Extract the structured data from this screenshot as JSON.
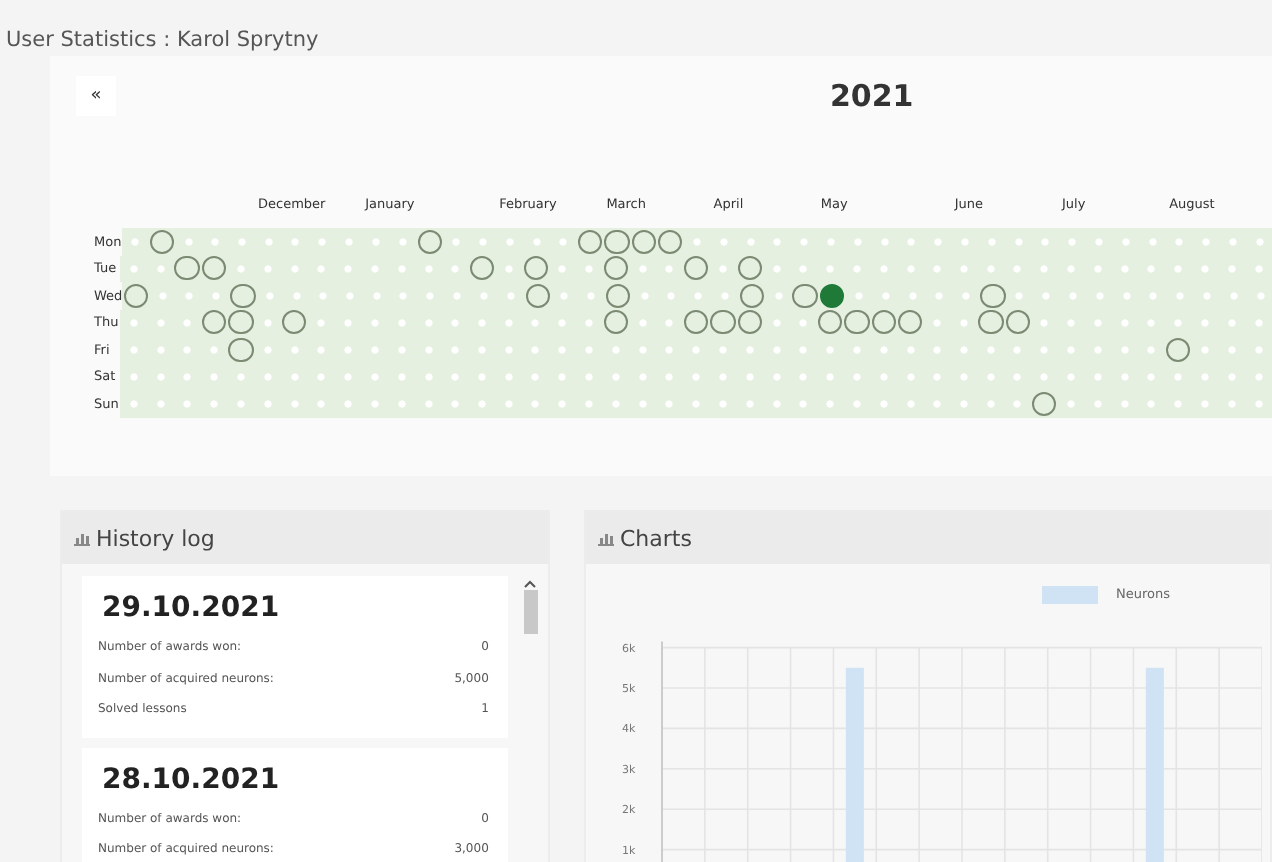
{
  "page_title": "User Statistics : Karol Sprytny",
  "calendar": {
    "back_button": "«",
    "year": "2021",
    "months": [
      {
        "label": "December"
      },
      {
        "label": "January"
      },
      {
        "label": "February"
      },
      {
        "label": "March"
      },
      {
        "label": "April"
      },
      {
        "label": "May"
      },
      {
        "label": "June"
      },
      {
        "label": "July"
      },
      {
        "label": "August"
      }
    ],
    "rows": [
      {
        "label": "Mon",
        "cells": [
          {
            "active": false
          },
          {
            "active": true
          },
          {
            "active": false
          },
          {
            "active": false
          },
          {
            "active": false
          },
          {
            "active": false
          },
          {
            "active": false
          },
          {
            "active": false
          },
          {
            "active": false
          },
          {
            "active": false
          },
          {
            "active": false
          },
          {
            "active": true
          },
          {
            "active": false
          },
          {
            "active": false
          },
          {
            "active": false
          },
          {
            "active": false
          },
          {
            "active": false
          },
          {
            "active": true
          },
          {
            "active": true
          },
          {
            "active": true
          },
          {
            "active": true
          },
          {
            "active": false
          },
          {
            "active": false
          },
          {
            "active": false
          },
          {
            "active": false
          },
          {
            "active": false
          },
          {
            "active": false
          },
          {
            "active": false
          },
          {
            "active": false
          },
          {
            "active": false
          },
          {
            "active": false
          },
          {
            "active": false
          },
          {
            "active": false
          },
          {
            "active": false
          },
          {
            "active": false
          },
          {
            "active": false
          },
          {
            "active": false
          },
          {
            "active": false
          },
          {
            "active": false
          },
          {
            "active": false
          },
          {
            "active": false
          },
          {
            "active": false
          },
          {
            "active": false
          }
        ]
      },
      {
        "label": "Tue",
        "cells": [
          {
            "active": false
          },
          {
            "active": false
          },
          {
            "active": true
          },
          {
            "active": true
          },
          {
            "active": false
          },
          {
            "active": false
          },
          {
            "active": false
          },
          {
            "active": false
          },
          {
            "active": false
          },
          {
            "active": false
          },
          {
            "active": false
          },
          {
            "active": false
          },
          {
            "active": false
          },
          {
            "active": true
          },
          {
            "active": false
          },
          {
            "active": true
          },
          {
            "active": false
          },
          {
            "active": false
          },
          {
            "active": true
          },
          {
            "active": false
          },
          {
            "active": false
          },
          {
            "active": true
          },
          {
            "active": false
          },
          {
            "active": true
          },
          {
            "active": false
          },
          {
            "active": false
          },
          {
            "active": false
          },
          {
            "active": false
          },
          {
            "active": false
          },
          {
            "active": false
          },
          {
            "active": false
          },
          {
            "active": false
          },
          {
            "active": false
          },
          {
            "active": false
          },
          {
            "active": false
          },
          {
            "active": false
          },
          {
            "active": false
          },
          {
            "active": false
          },
          {
            "active": false
          },
          {
            "active": false
          },
          {
            "active": false
          },
          {
            "active": false
          },
          {
            "active": false
          }
        ]
      },
      {
        "label": "Wed",
        "cells": [
          {
            "active": true
          },
          {
            "active": false
          },
          {
            "active": false
          },
          {
            "active": false
          },
          {
            "active": true
          },
          {
            "active": false
          },
          {
            "active": false
          },
          {
            "active": false
          },
          {
            "active": false
          },
          {
            "active": false
          },
          {
            "active": false
          },
          {
            "active": false
          },
          {
            "active": false
          },
          {
            "active": false
          },
          {
            "active": false
          },
          {
            "active": true
          },
          {
            "active": false
          },
          {
            "active": false
          },
          {
            "active": true
          },
          {
            "active": false
          },
          {
            "active": false
          },
          {
            "active": false
          },
          {
            "active": false
          },
          {
            "active": true
          },
          {
            "active": false
          },
          {
            "active": true
          },
          {
            "active": true,
            "selected": true
          },
          {
            "active": false
          },
          {
            "active": false
          },
          {
            "active": false
          },
          {
            "active": false
          },
          {
            "active": false
          },
          {
            "active": true
          },
          {
            "active": false
          },
          {
            "active": false
          },
          {
            "active": false
          },
          {
            "active": false
          },
          {
            "active": false
          },
          {
            "active": false
          },
          {
            "active": false
          },
          {
            "active": false
          },
          {
            "active": false
          },
          {
            "active": false
          }
        ]
      },
      {
        "label": "Thu",
        "cells": [
          {
            "active": false
          },
          {
            "active": false
          },
          {
            "active": false
          },
          {
            "active": true
          },
          {
            "active": true
          },
          {
            "active": false
          },
          {
            "active": true
          },
          {
            "active": false
          },
          {
            "active": false
          },
          {
            "active": false
          },
          {
            "active": false
          },
          {
            "active": false
          },
          {
            "active": false
          },
          {
            "active": false
          },
          {
            "active": false
          },
          {
            "active": false
          },
          {
            "active": false
          },
          {
            "active": false
          },
          {
            "active": true
          },
          {
            "active": false
          },
          {
            "active": false
          },
          {
            "active": true
          },
          {
            "active": true
          },
          {
            "active": true
          },
          {
            "active": false
          },
          {
            "active": false
          },
          {
            "active": true
          },
          {
            "active": true
          },
          {
            "active": true
          },
          {
            "active": true
          },
          {
            "active": false
          },
          {
            "active": false
          },
          {
            "active": true
          },
          {
            "active": true
          },
          {
            "active": false
          },
          {
            "active": false
          },
          {
            "active": false
          },
          {
            "active": false
          },
          {
            "active": false
          },
          {
            "active": false
          },
          {
            "active": false
          },
          {
            "active": false
          },
          {
            "active": false
          }
        ]
      },
      {
        "label": "Fri",
        "cells": [
          {
            "active": false
          },
          {
            "active": false
          },
          {
            "active": false
          },
          {
            "active": false
          },
          {
            "active": true
          },
          {
            "active": false
          },
          {
            "active": false
          },
          {
            "active": false
          },
          {
            "active": false
          },
          {
            "active": false
          },
          {
            "active": false
          },
          {
            "active": false
          },
          {
            "active": false
          },
          {
            "active": false
          },
          {
            "active": false
          },
          {
            "active": false
          },
          {
            "active": false
          },
          {
            "active": false
          },
          {
            "active": false
          },
          {
            "active": false
          },
          {
            "active": false
          },
          {
            "active": false
          },
          {
            "active": false
          },
          {
            "active": false
          },
          {
            "active": false
          },
          {
            "active": false
          },
          {
            "active": false
          },
          {
            "active": false
          },
          {
            "active": false
          },
          {
            "active": false
          },
          {
            "active": false
          },
          {
            "active": false
          },
          {
            "active": false
          },
          {
            "active": false
          },
          {
            "active": false
          },
          {
            "active": false
          },
          {
            "active": false
          },
          {
            "active": false
          },
          {
            "active": false
          },
          {
            "active": true
          },
          {
            "active": false
          },
          {
            "active": false
          },
          {
            "active": false
          }
        ]
      },
      {
        "label": "Sat",
        "cells": [
          {
            "active": false
          },
          {
            "active": false
          },
          {
            "active": false
          },
          {
            "active": false
          },
          {
            "active": false
          },
          {
            "active": false
          },
          {
            "active": false
          },
          {
            "active": false
          },
          {
            "active": false
          },
          {
            "active": false
          },
          {
            "active": false
          },
          {
            "active": false
          },
          {
            "active": false
          },
          {
            "active": false
          },
          {
            "active": false
          },
          {
            "active": false
          },
          {
            "active": false
          },
          {
            "active": false
          },
          {
            "active": false
          },
          {
            "active": false
          },
          {
            "active": false
          },
          {
            "active": false
          },
          {
            "active": false
          },
          {
            "active": false
          },
          {
            "active": false
          },
          {
            "active": false
          },
          {
            "active": false
          },
          {
            "active": false
          },
          {
            "active": false
          },
          {
            "active": false
          },
          {
            "active": false
          },
          {
            "active": false
          },
          {
            "active": false
          },
          {
            "active": false
          },
          {
            "active": false
          },
          {
            "active": false
          },
          {
            "active": false
          },
          {
            "active": false
          },
          {
            "active": false
          },
          {
            "active": false
          },
          {
            "active": false
          },
          {
            "active": false
          },
          {
            "active": false
          }
        ]
      },
      {
        "label": "Sun",
        "cells": [
          {
            "active": false
          },
          {
            "active": false
          },
          {
            "active": false
          },
          {
            "active": false
          },
          {
            "active": false
          },
          {
            "active": false
          },
          {
            "active": false
          },
          {
            "active": false
          },
          {
            "active": false
          },
          {
            "active": false
          },
          {
            "active": false
          },
          {
            "active": false
          },
          {
            "active": false
          },
          {
            "active": false
          },
          {
            "active": false
          },
          {
            "active": false
          },
          {
            "active": false
          },
          {
            "active": false
          },
          {
            "active": false
          },
          {
            "active": false
          },
          {
            "active": false
          },
          {
            "active": false
          },
          {
            "active": false
          },
          {
            "active": false
          },
          {
            "active": false
          },
          {
            "active": false
          },
          {
            "active": false
          },
          {
            "active": false
          },
          {
            "active": false
          },
          {
            "active": false
          },
          {
            "active": false
          },
          {
            "active": false
          },
          {
            "active": false
          },
          {
            "active": false
          },
          {
            "active": true
          },
          {
            "active": false
          },
          {
            "active": false
          },
          {
            "active": false
          },
          {
            "active": false
          },
          {
            "active": false
          },
          {
            "active": false
          },
          {
            "active": false
          },
          {
            "active": false
          }
        ]
      }
    ]
  },
  "history_log": {
    "title": "History log",
    "entries": [
      {
        "date": "29.10.2021",
        "stats": [
          {
            "label": "Number of awards won:",
            "value": "0"
          },
          {
            "label": "Number of acquired neurons:",
            "value": "5,000"
          },
          {
            "label": "Solved lessons",
            "value": "1"
          }
        ]
      },
      {
        "date": "28.10.2021",
        "stats": [
          {
            "label": "Number of awards won:",
            "value": "0"
          },
          {
            "label": "Number of acquired neurons:",
            "value": "3,000"
          }
        ]
      }
    ]
  },
  "charts": {
    "title": "Charts",
    "chart_data": {
      "type": "bar",
      "grid": true,
      "ylim": [
        0,
        6000
      ],
      "series": [
        {
          "name": "Neurons",
          "color": "#cfe3f5",
          "values": [
            null,
            null,
            null,
            null,
            5500,
            null,
            null,
            null,
            null,
            null,
            null,
            5500,
            null,
            null
          ]
        }
      ],
      "yticks": [
        {
          "value": 1000,
          "label": "1k"
        },
        {
          "value": 2000,
          "label": "2k"
        },
        {
          "value": 3000,
          "label": "3k"
        },
        {
          "value": 4000,
          "label": "4k"
        },
        {
          "value": 5000,
          "label": "5k"
        },
        {
          "value": 6000,
          "label": "6k"
        }
      ]
    }
  }
}
